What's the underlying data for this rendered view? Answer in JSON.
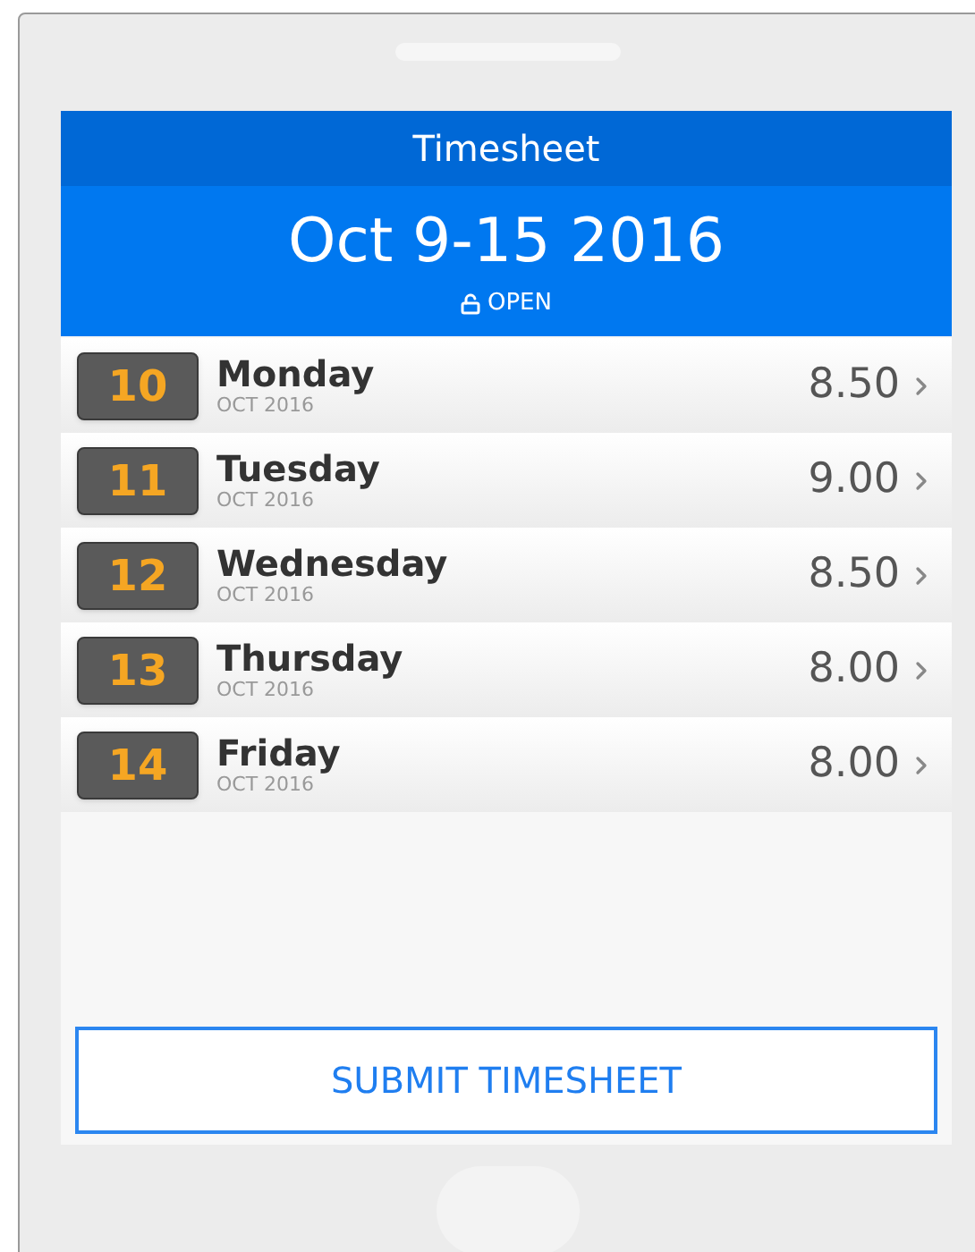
{
  "header": {
    "title": "Timesheet",
    "period": "Oct 9-15 2016",
    "status": "OPEN"
  },
  "days": [
    {
      "date": "10",
      "name": "Monday",
      "month": "OCT 2016",
      "hours": "8.50"
    },
    {
      "date": "11",
      "name": "Tuesday",
      "month": "OCT 2016",
      "hours": "9.00"
    },
    {
      "date": "12",
      "name": "Wednesday",
      "month": "OCT 2016",
      "hours": "8.50"
    },
    {
      "date": "13",
      "name": "Thursday",
      "month": "OCT 2016",
      "hours": "8.00"
    },
    {
      "date": "14",
      "name": "Friday",
      "month": "OCT 2016",
      "hours": "8.00"
    }
  ],
  "submit_button": "SUBMIT TIMESHEET"
}
